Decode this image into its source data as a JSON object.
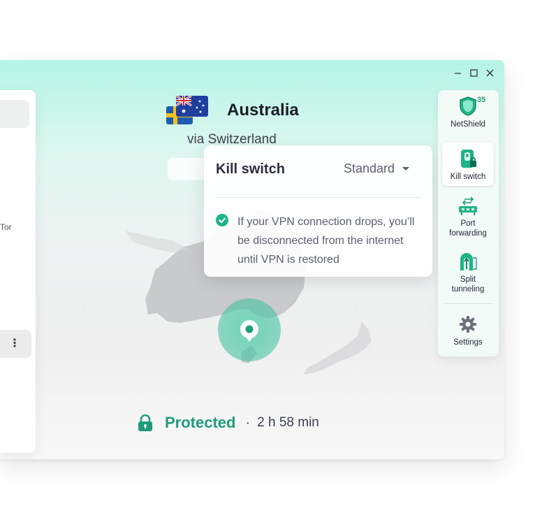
{
  "connection": {
    "country": "Australia",
    "via": "via Switzerland",
    "status": "Protected",
    "separator": "·",
    "duration": "2 h 58 min"
  },
  "left_panel": {
    "partial_text": "Tor"
  },
  "kill_switch_popup": {
    "title": "Kill switch",
    "mode": "Standard",
    "description": "If your VPN connection drops, you’ll be disconnected from the internet until VPN is restored"
  },
  "features": [
    {
      "label": "NetShield",
      "badge": "35",
      "icon": "shield-icon"
    },
    {
      "label": "Kill switch",
      "icon": "kill-switch-icon"
    },
    {
      "label": "Port forwarding",
      "icon": "port-forwarding-icon"
    },
    {
      "label": "Split tunneling",
      "icon": "split-tunneling-icon"
    },
    {
      "label": "Settings",
      "icon": "gear-icon"
    }
  ],
  "colors": {
    "accent": "#1f9c79",
    "header_gradient": "#b4f5e6"
  }
}
